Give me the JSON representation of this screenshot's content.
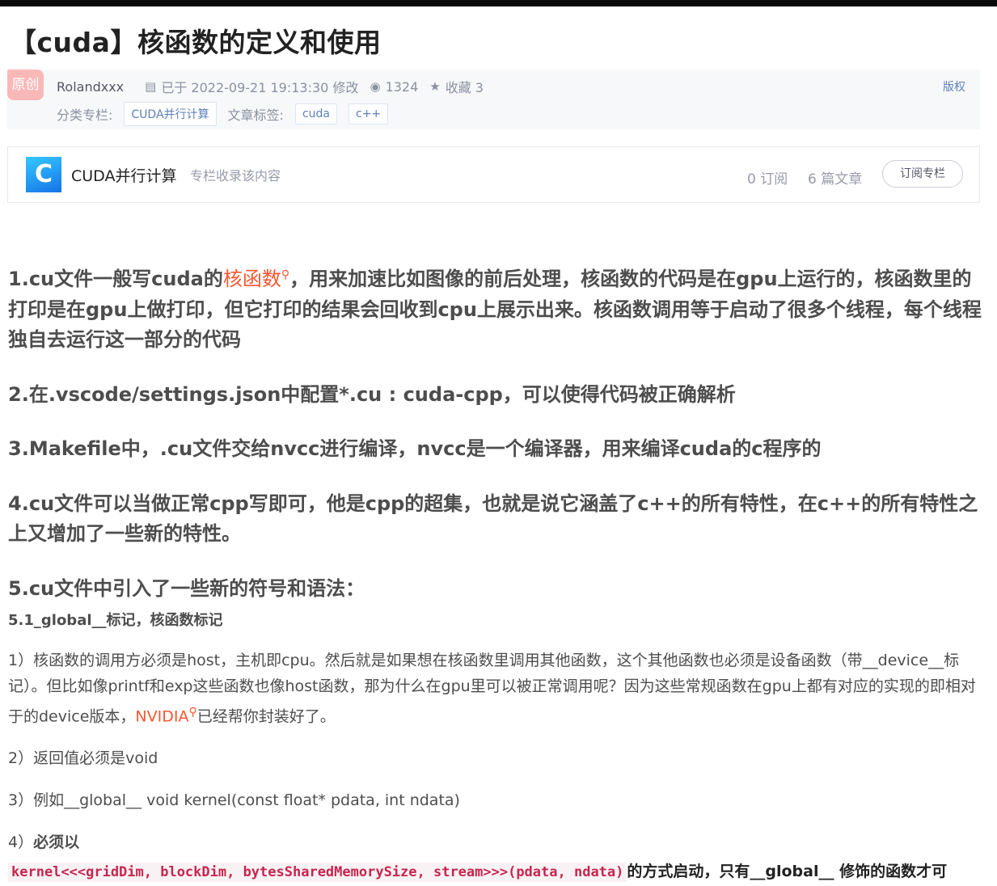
{
  "title": "【cuda】核函数的定义和使用",
  "meta": {
    "original_badge": "原创",
    "author": "Rolandxxx",
    "modified": "已于 2022-09-21 19:13:30 修改",
    "views": "1324",
    "favorites": "收藏 3",
    "rights": "版权",
    "category_label": "分类专栏:",
    "category": "CUDA并行计算",
    "tags_label": "文章标签:",
    "tags": [
      "cuda",
      "c++"
    ]
  },
  "column": {
    "logo": "C",
    "name": "CUDA并行计算",
    "subtitle": "专栏收录该内容",
    "subscribers": "0 订阅",
    "articles": "6 篇文章",
    "subscribe_button": "订阅专栏"
  },
  "article": {
    "p1_a": "1.cu文件一般写cuda的",
    "p1_link": "核函数",
    "p1_b": "，用来加速比如图像的前后处理，核函数的代码是在gpu上运行的，核函数里的打印是在gpu上做打印，但它打印的结果会回收到cpu上展示出来。核函数调用等于启动了很多个线程，每个线程独自去运行这一部分的代码",
    "p2": "2.在.vscode/settings.json中配置*.cu : cuda-cpp，可以使得代码被正确解析",
    "p3": "3.Makefile中，.cu文件交给nvcc进行编译，nvcc是一个编译器，用来编译cuda的c程序的",
    "p4": "4.cu文件可以当做正常cpp写即可，他是cpp的超集，也就是说它涵盖了c++的所有特性，在c++的所有特性之上又增加了一些新的特性。",
    "p5": "5.cu文件中引入了一些新的符号和语法：",
    "p5_1": "5.1_global__标记，核函数标记",
    "i1_a": "1）核函数的调用方必须是host，主机即cpu。然后就是如果想在核函数里调用其他函数，这个其他函数也必须是设备函数（带__device__标记）。但比如像printf和exp这些函数也像host函数，那为什么在gpu里可以被正常调用呢？因为这些常规函数在gpu上都有对应的实现的即相对于的device版本，",
    "i1_link": "NVIDIA",
    "i1_b": "已经帮你封装好了。",
    "i2": "2）返回值必须是void",
    "i3": "3）例如__global__ void kernel(const float* pdata, int ndata)",
    "i4_prefix": "4）",
    "i4_bold": "必须以",
    "i4_code": "kernel<<<gridDim, blockDim, bytesSharedMemorySize, stream>>>(pdata, ndata)",
    "i4_rest": "的方式启动，只有__global__ 修饰的函数才可"
  }
}
